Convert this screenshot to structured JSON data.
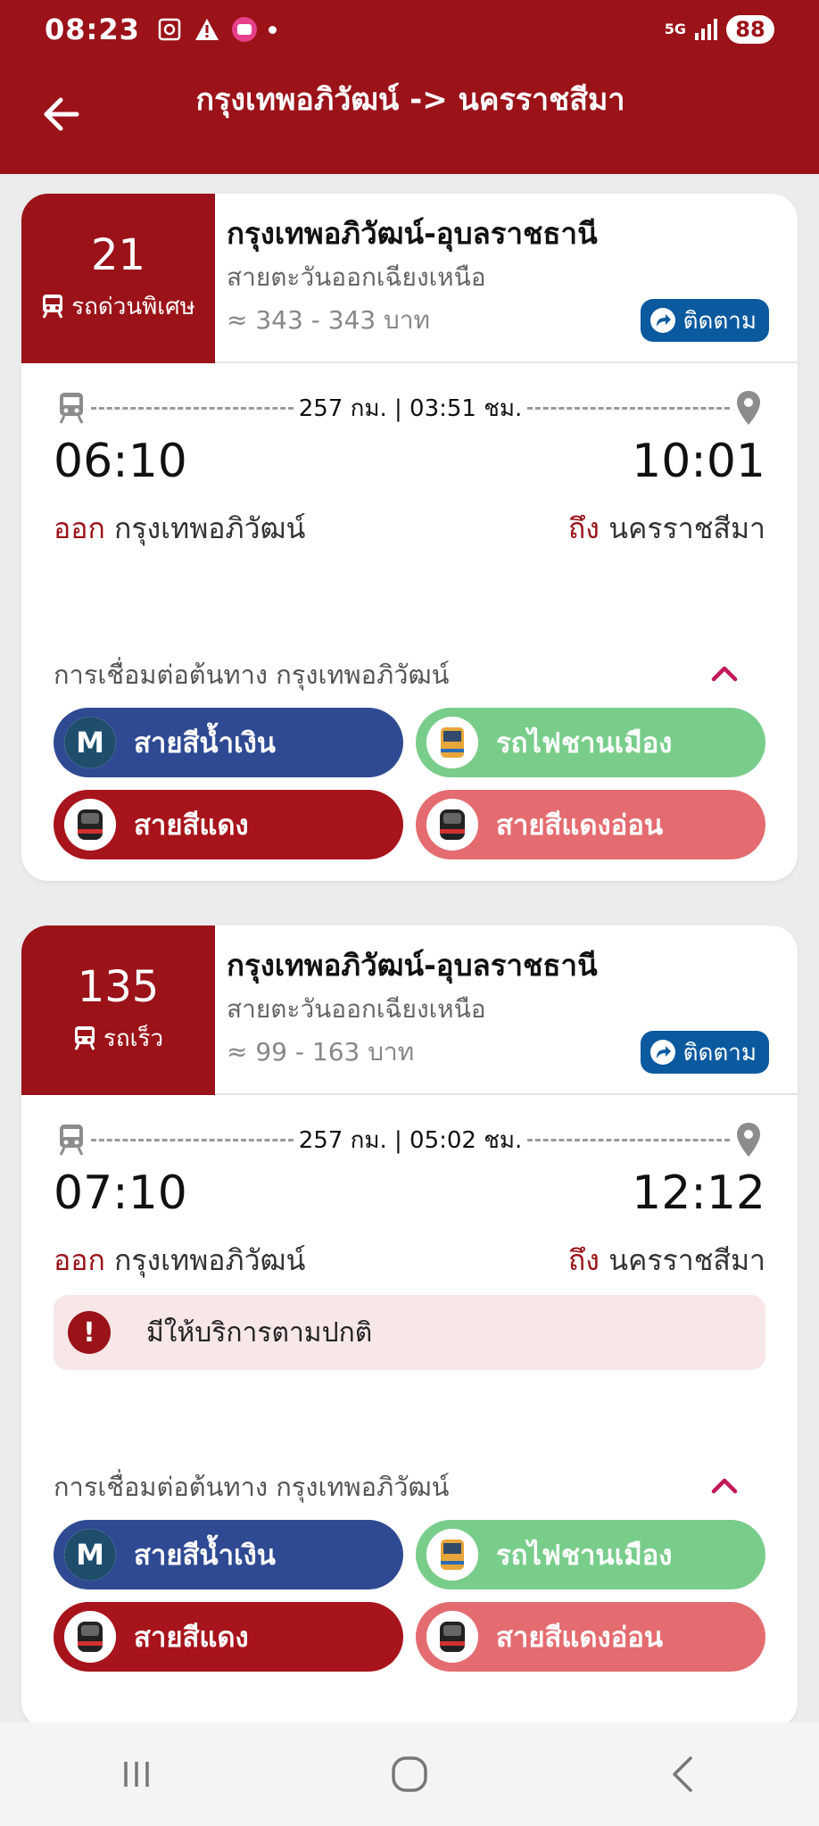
{
  "status_bar": {
    "time": "08:23",
    "network": "5G",
    "battery": "88"
  },
  "header": {
    "title": "กรุงเทพอภิวัฒน์ -> นครราชสีมา"
  },
  "trains": [
    {
      "number": "21",
      "type": "รถด่วนพิเศษ",
      "route": "กรุงเทพอภิวัฒน์-อุบลราชธานี",
      "line": "สายตะวันออกเฉียงเหนือ",
      "fare": "≈ 343 - 343 บาท",
      "follow_label": "ติดตาม",
      "distance_duration": "257 กม. | 03:51 ชม.",
      "depart_time": "06:10",
      "arrive_time": "10:01",
      "depart_prefix": "ออก",
      "depart_station": "กรุงเทพอภิวัฒน์",
      "arrive_prefix": "ถึง",
      "arrive_station": "นครราชสีมา",
      "connection_label": "การเชื่อมต่อต้นทาง กรุงเทพอภิวัฒน์",
      "connections": [
        "สายสีน้ำเงิน",
        "รถไฟชานเมือง",
        "สายสีแดง",
        "สายสีแดงอ่อน"
      ]
    },
    {
      "number": "135",
      "type": "รถเร็ว",
      "route": "กรุงเทพอภิวัฒน์-อุบลราชธานี",
      "line": "สายตะวันออกเฉียงเหนือ",
      "fare": "≈ 99 - 163 บาท",
      "follow_label": "ติดตาม",
      "distance_duration": "257 กม. | 05:02 ชม.",
      "depart_time": "07:10",
      "arrive_time": "12:12",
      "depart_prefix": "ออก",
      "depart_station": "กรุงเทพอภิวัฒน์",
      "arrive_prefix": "ถึง",
      "arrive_station": "นครราชสีมา",
      "notice": "มีให้บริการตามปกติ",
      "connection_label": "การเชื่อมต่อต้นทาง กรุงเทพอภิวัฒน์",
      "connections": [
        "สายสีน้ำเงิน",
        "รถไฟชานเมือง",
        "สายสีแดง",
        "สายสีแดงอ่อน"
      ]
    }
  ],
  "colors": {
    "brand": "#9b1219",
    "follow": "#0b5aa0",
    "blue_line": "#2f4a93",
    "commuter": "#79cd8b",
    "red_line": "#a8141b",
    "light_red_line": "#e46c70"
  },
  "icons": [
    "back-arrow-icon",
    "train-icon",
    "share-arrow-icon",
    "location-pin-icon",
    "chevron-up-icon",
    "metro-m-icon",
    "info-icon",
    "recents-icon",
    "home-icon",
    "back-nav-icon"
  ]
}
